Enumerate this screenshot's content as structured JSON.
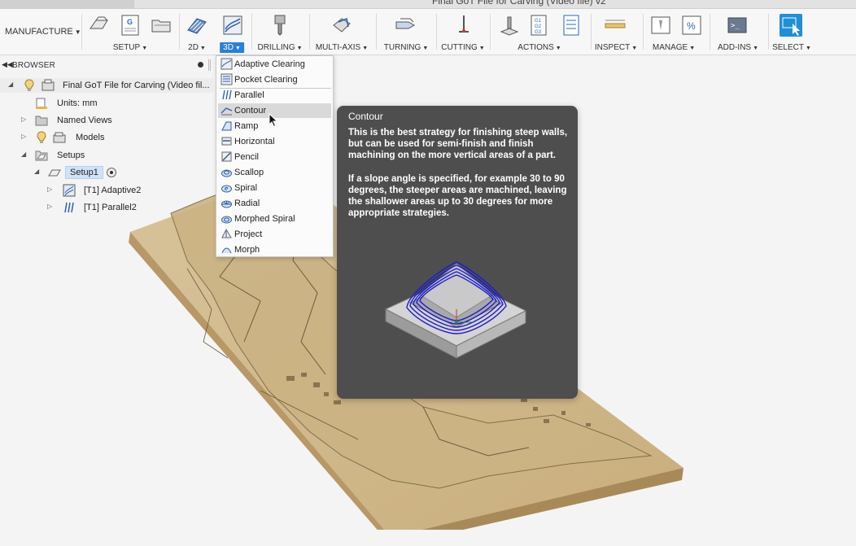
{
  "window": {
    "title": "Final GoT File for Carving (Video file) v2"
  },
  "toolbar": {
    "workspace": "MANUFACTURE",
    "groups": [
      {
        "label": "SETUP"
      },
      {
        "label": "2D"
      },
      {
        "label": "3D"
      },
      {
        "label": "DRILLING"
      },
      {
        "label": "MULTI-AXIS"
      },
      {
        "label": "TURNING"
      },
      {
        "label": "CUTTING"
      },
      {
        "label": "ACTIONS"
      },
      {
        "label": "INSPECT"
      },
      {
        "label": "MANAGE"
      },
      {
        "label": "ADD-INS"
      },
      {
        "label": "SELECT"
      }
    ],
    "active_group": "3D",
    "active_color": "#2c7fd6"
  },
  "browser": {
    "title": "BROWSER",
    "items": [
      {
        "label": "Final GoT File for Carving (Video fil..."
      },
      {
        "label": "Units: mm"
      },
      {
        "label": "Named Views"
      },
      {
        "label": "Models"
      },
      {
        "label": "Setups"
      },
      {
        "label": "Setup1"
      },
      {
        "label": "[T1] Adaptive2"
      },
      {
        "label": "[T1] Parallel2"
      }
    ]
  },
  "menu": {
    "items": [
      {
        "label": "Adaptive Clearing"
      },
      {
        "label": "Pocket Clearing"
      },
      {
        "label": "Parallel"
      },
      {
        "label": "Contour"
      },
      {
        "label": "Ramp"
      },
      {
        "label": "Horizontal"
      },
      {
        "label": "Pencil"
      },
      {
        "label": "Scallop"
      },
      {
        "label": "Spiral"
      },
      {
        "label": "Radial"
      },
      {
        "label": "Morphed Spiral"
      },
      {
        "label": "Project"
      },
      {
        "label": "Morph"
      }
    ],
    "hovered": "Contour"
  },
  "tooltip": {
    "title": "Contour",
    "paragraph1": "This is the best strategy for finishing steep walls, but can be used for semi-finish and finish machining on the more vertical areas of a part.",
    "paragraph2": "If a slope angle is specified, for example 30 to 90 degrees, the steeper areas are machined, leaving the shallower areas up to 30 degrees for more appropriate strategies."
  }
}
